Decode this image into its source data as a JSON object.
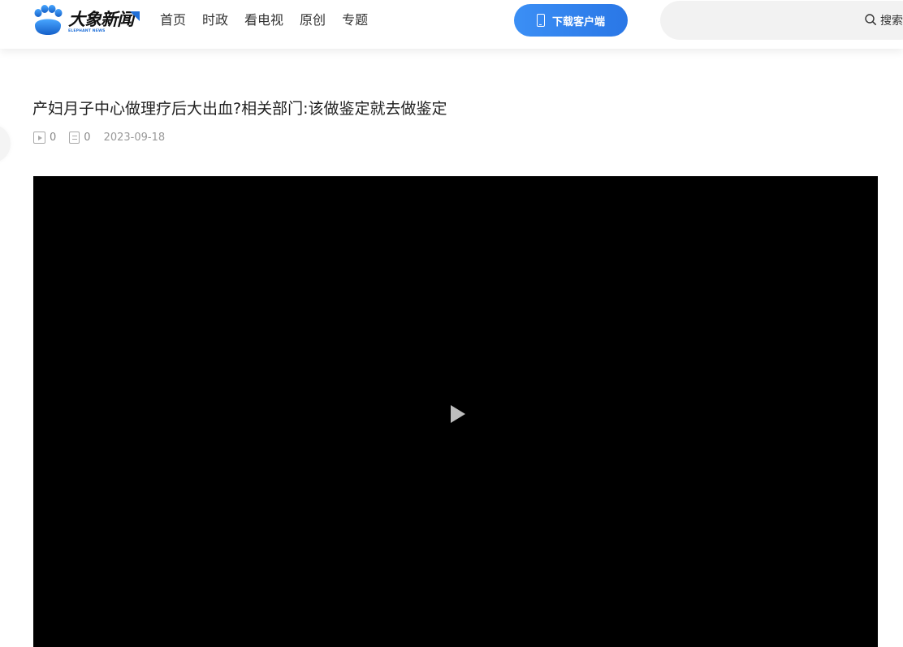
{
  "header": {
    "logo": {
      "name_cn": "大象新闻",
      "name_en": "ELEPHANT NEWS",
      "icon": "paw-logo-icon"
    },
    "nav": [
      {
        "label": "首页"
      },
      {
        "label": "时政"
      },
      {
        "label": "看电视"
      },
      {
        "label": "原创"
      },
      {
        "label": "专题"
      }
    ],
    "download_button": {
      "label": "下载客户端",
      "icon": "phone-icon"
    },
    "search": {
      "label": "搜索",
      "placeholder": "",
      "icon": "search-icon"
    }
  },
  "article": {
    "title": "产妇月子中心做理疗后大出血?相关部门:该做鉴定就去做鉴定",
    "play_count": "0",
    "comment_count": "0",
    "date": "2023-09-18"
  },
  "video": {
    "play_icon": "play-icon"
  },
  "colors": {
    "brand_blue": "#2a77e6",
    "video_bg": "#000000",
    "search_bg": "#f2f2f2"
  }
}
